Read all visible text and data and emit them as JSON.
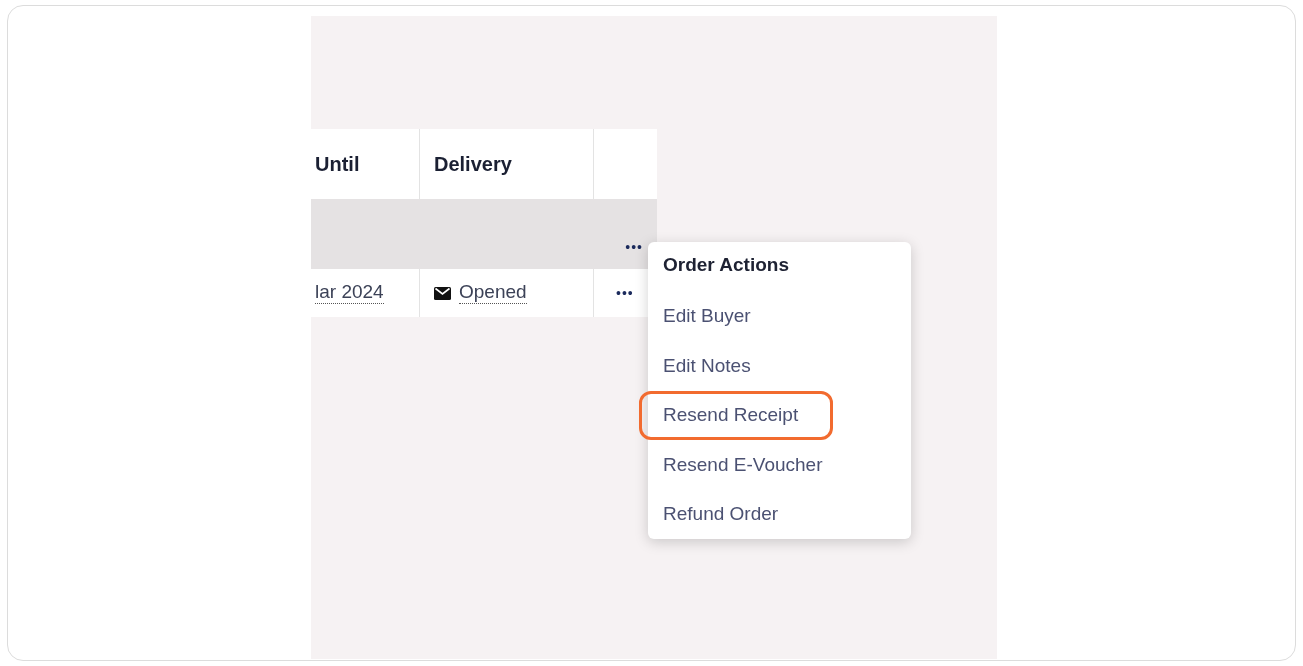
{
  "table": {
    "columns": [
      "Until",
      "Delivery"
    ],
    "group_row": {
      "actions": "•••"
    },
    "rows": [
      {
        "until": "lar 2024",
        "delivery": "Opened",
        "actions": "•••"
      }
    ]
  },
  "menu": {
    "title": "Order Actions",
    "items": [
      {
        "label": "Edit Buyer",
        "highlighted": false
      },
      {
        "label": "Edit Notes",
        "highlighted": false
      },
      {
        "label": "Resend Receipt",
        "highlighted": true
      },
      {
        "label": "Resend E-Voucher",
        "highlighted": false
      },
      {
        "label": "Refund Order",
        "highlighted": false
      }
    ]
  }
}
